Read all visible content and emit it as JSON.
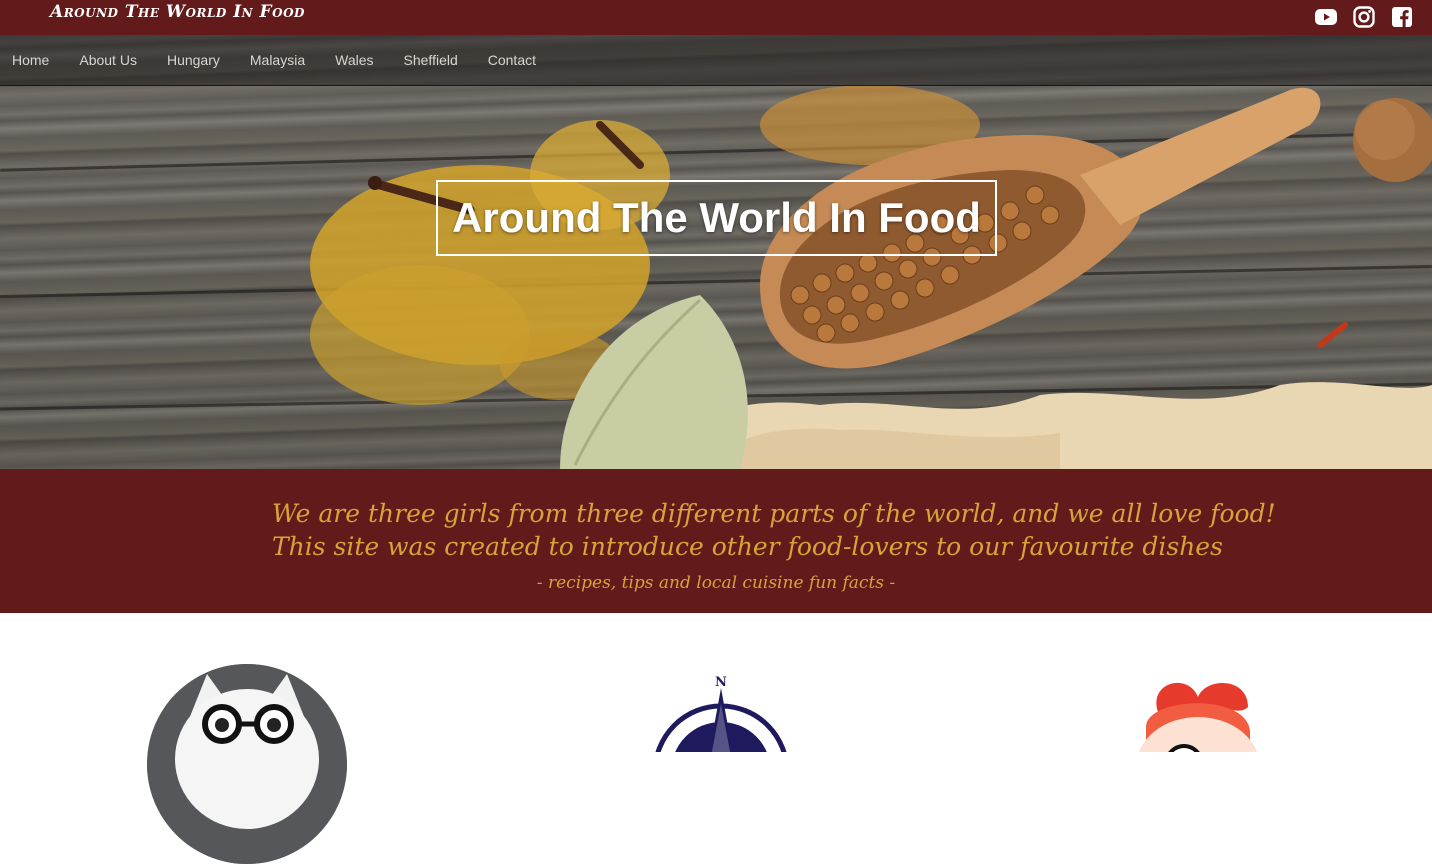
{
  "brand": {
    "logo_text": "Around The World In Food"
  },
  "social": {
    "icons": [
      "youtube-icon",
      "instagram-icon",
      "facebook-icon"
    ]
  },
  "nav": {
    "items": [
      "Home",
      "About Us",
      "Hungary",
      "Malaysia",
      "Wales",
      "Sheffield",
      "Contact"
    ]
  },
  "hero": {
    "title": "Around The World In Food"
  },
  "intro": {
    "line1": "We are three girls from three different parts of the world, and we all love food!",
    "line2": "This site was created to introduce other food-lovers to our favourite dishes",
    "line3": "- recipes, tips and local cuisine fun facts -"
  },
  "profiles": [
    {
      "icon": "cat-with-glasses-avatar"
    },
    {
      "icon": "compass-rose-icon"
    },
    {
      "icon": "cartoon-girl-avatar"
    }
  ],
  "colors": {
    "brand_maroon": "#621a1b",
    "intro_text_gold": "#d6a439",
    "nav_text": "#d9d5d1"
  }
}
